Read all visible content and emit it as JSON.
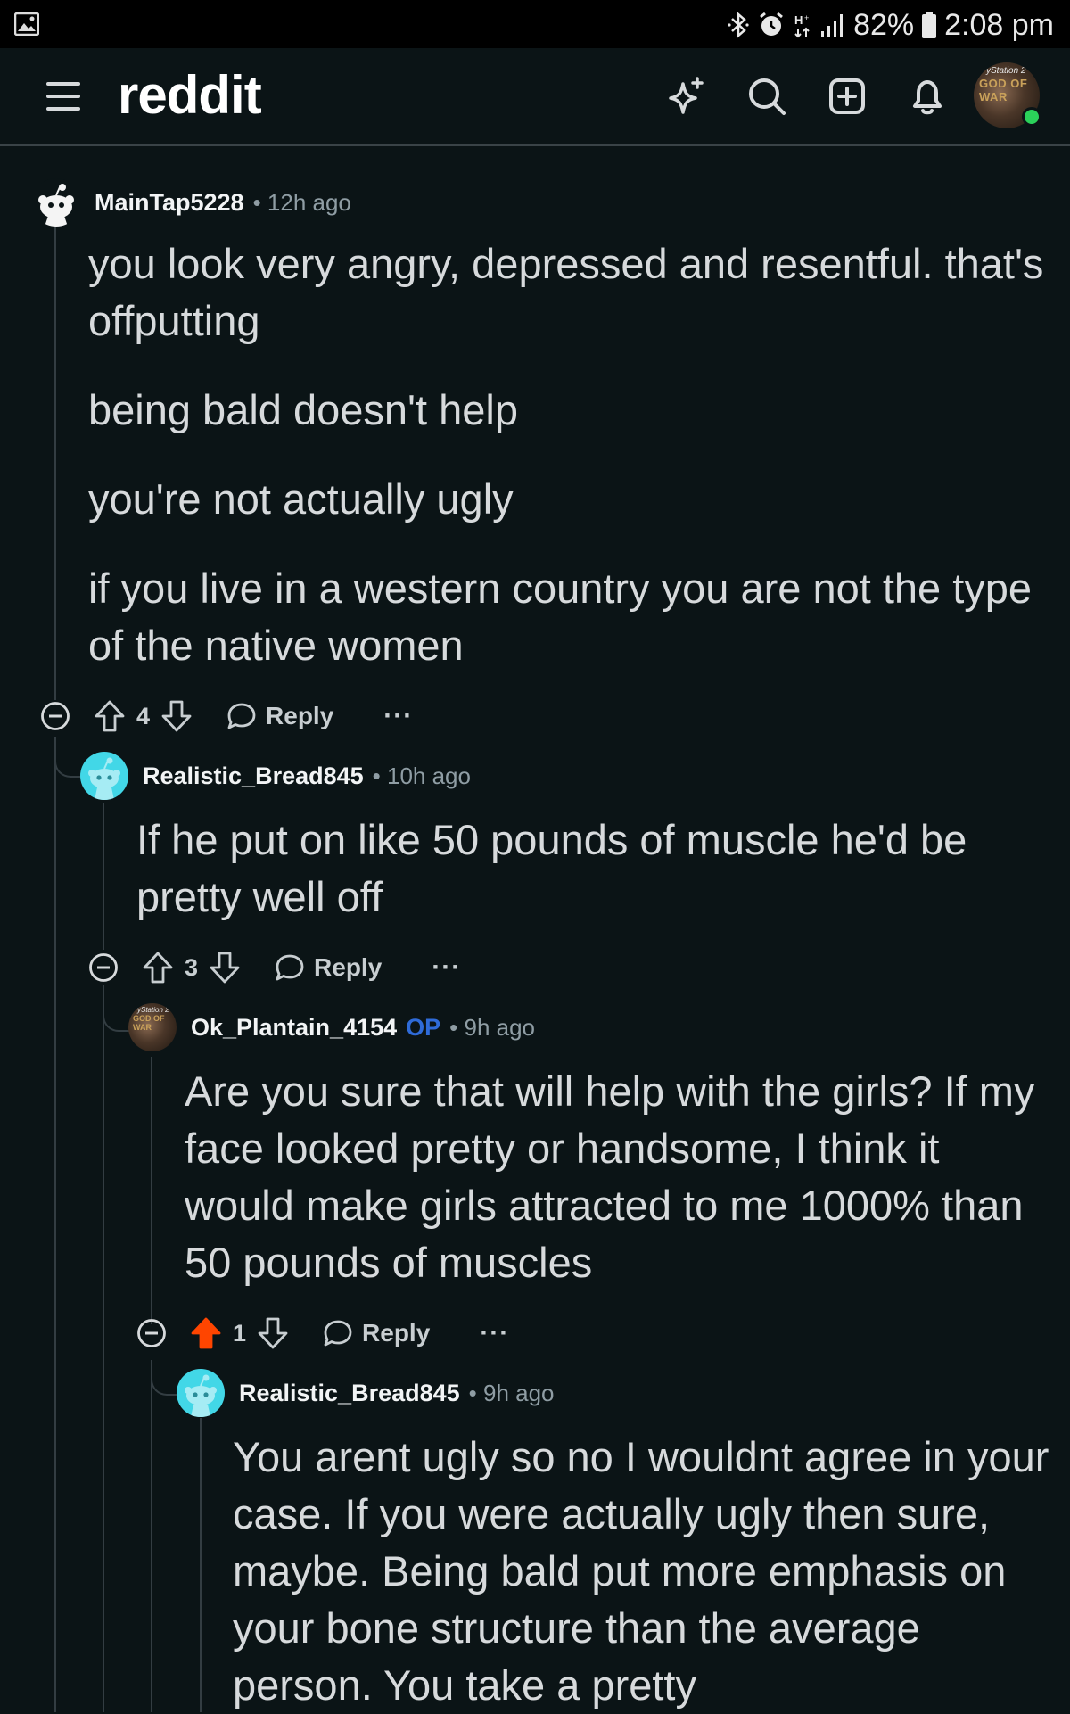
{
  "status_bar": {
    "battery": "82%",
    "time": "2:08 pm",
    "icons": [
      "gallery-icon",
      "bluetooth-icon",
      "alarm-icon",
      "network-h-icon",
      "signal-icon",
      "battery-icon"
    ]
  },
  "header": {
    "logo": "reddit",
    "icons": [
      "menu-icon",
      "sparkle-icon",
      "search-icon",
      "create-post-icon",
      "notifications-icon"
    ],
    "avatar_text_top": "yStation 2",
    "avatar_text": "GOD OF WAR"
  },
  "comments": [
    {
      "username": "MainTap5228",
      "time": "12h ago",
      "paragraphs": [
        "you look very angry, depressed and resentful. that's offputting",
        "being bald doesn't help",
        "you're not actually ugly",
        "if you live in a western country you are not the type of the native women"
      ],
      "votes": "4",
      "reply_label": "Reply",
      "more_label": "···"
    },
    {
      "username": "Realistic_Bread845",
      "time": "10h ago",
      "paragraphs": [
        "If he put on like 50 pounds of muscle he'd be pretty well off"
      ],
      "votes": "3",
      "reply_label": "Reply",
      "more_label": "···"
    },
    {
      "username": "Ok_Plantain_4154",
      "op_label": "OP",
      "time": "9h ago",
      "paragraphs": [
        "Are you sure that will help with the girls? If my face looked pretty or handsome, I think it would make girls attracted to me 1000% than 50 pounds of muscles"
      ],
      "votes": "1",
      "upvoted": true,
      "reply_label": "Reply",
      "more_label": "···"
    },
    {
      "username": "Realistic_Bread845",
      "time": "9h ago",
      "paragraphs": [
        "You arent ugly so no I wouldnt agree in your case. If you were actually ugly then sure, maybe. Being bald put more emphasis on your bone structure than the average person. You take a pretty"
      ]
    }
  ],
  "colors": {
    "background": "#0b1416",
    "upvote_active": "#ff4500",
    "op": "#2f6bd8",
    "snoo_teal": "#42d7e7"
  }
}
